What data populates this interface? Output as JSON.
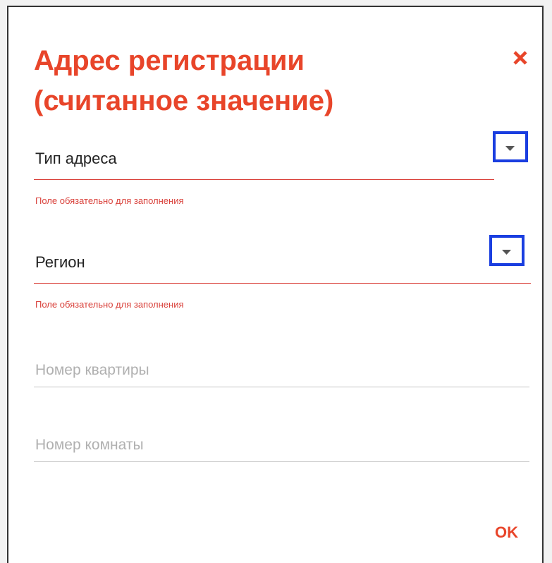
{
  "dialog": {
    "title_line1": "Адрес регистрации",
    "title_line2": "(считанное значение)",
    "close_icon": "close-icon",
    "accent_color": "#e8452a"
  },
  "fields": {
    "address_type": {
      "value": "Тип адреса",
      "error": "Поле обязательно для заполнения",
      "dropdown_icon": "caret-down-icon"
    },
    "region": {
      "value": "Регион",
      "error": "Поле обязательно для заполнения",
      "dropdown_icon": "caret-down-icon"
    },
    "apartment": {
      "placeholder": "Номер квартиры"
    },
    "room": {
      "placeholder": "Номер комнаты"
    }
  },
  "actions": {
    "ok_label": "OK"
  }
}
